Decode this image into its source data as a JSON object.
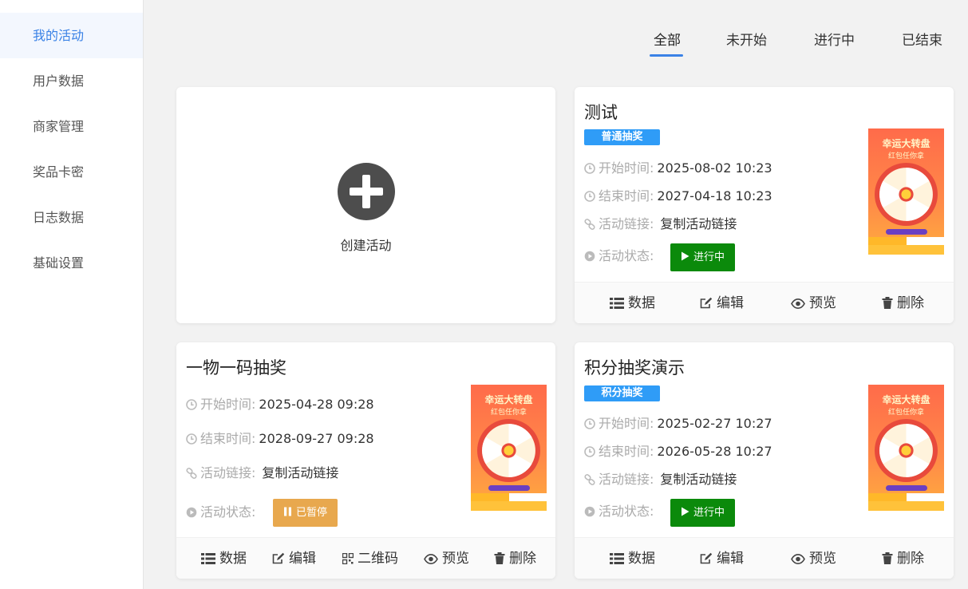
{
  "sidebar": {
    "items": [
      {
        "label": "我的活动",
        "active": true
      },
      {
        "label": "用户数据"
      },
      {
        "label": "商家管理"
      },
      {
        "label": "奖品卡密"
      },
      {
        "label": "日志数据"
      },
      {
        "label": "基础设置"
      }
    ]
  },
  "tabs": {
    "items": [
      {
        "label": "全部",
        "active": true
      },
      {
        "label": "未开始"
      },
      {
        "label": "进行中"
      },
      {
        "label": "已结束"
      }
    ]
  },
  "create": {
    "label": "创建活动"
  },
  "labels": {
    "start": "开始时间:",
    "end": "结束时间:",
    "link": "活动链接:",
    "status": "活动状态:",
    "copy_link": "复制活动链接"
  },
  "footer_labels": {
    "data": "数据",
    "edit": "编辑",
    "qrcode": "二维码",
    "preview": "预览",
    "delete": "删除"
  },
  "thumbnail": {
    "title": "幸运大转盘",
    "subtitle": "红包任你拿"
  },
  "activities": [
    {
      "title": "测试",
      "badge": "普通抽奖",
      "start": "2025-08-02 10:23",
      "end": "2027-04-18 10:23",
      "status": "进行中"
    },
    {
      "title": "一物一码抽奖",
      "start": "2025-04-28 09:28",
      "end": "2028-09-27 09:28",
      "status": "已暂停"
    },
    {
      "title": "积分抽奖演示",
      "badge": "积分抽奖",
      "start": "2025-02-27 10:27",
      "end": "2026-05-28 10:27",
      "status": "进行中"
    }
  ],
  "colors": {
    "accent": "#3a82e6",
    "badge": "#2f9cf7",
    "running": "#0b8a0b",
    "paused": "#e8a84e"
  }
}
